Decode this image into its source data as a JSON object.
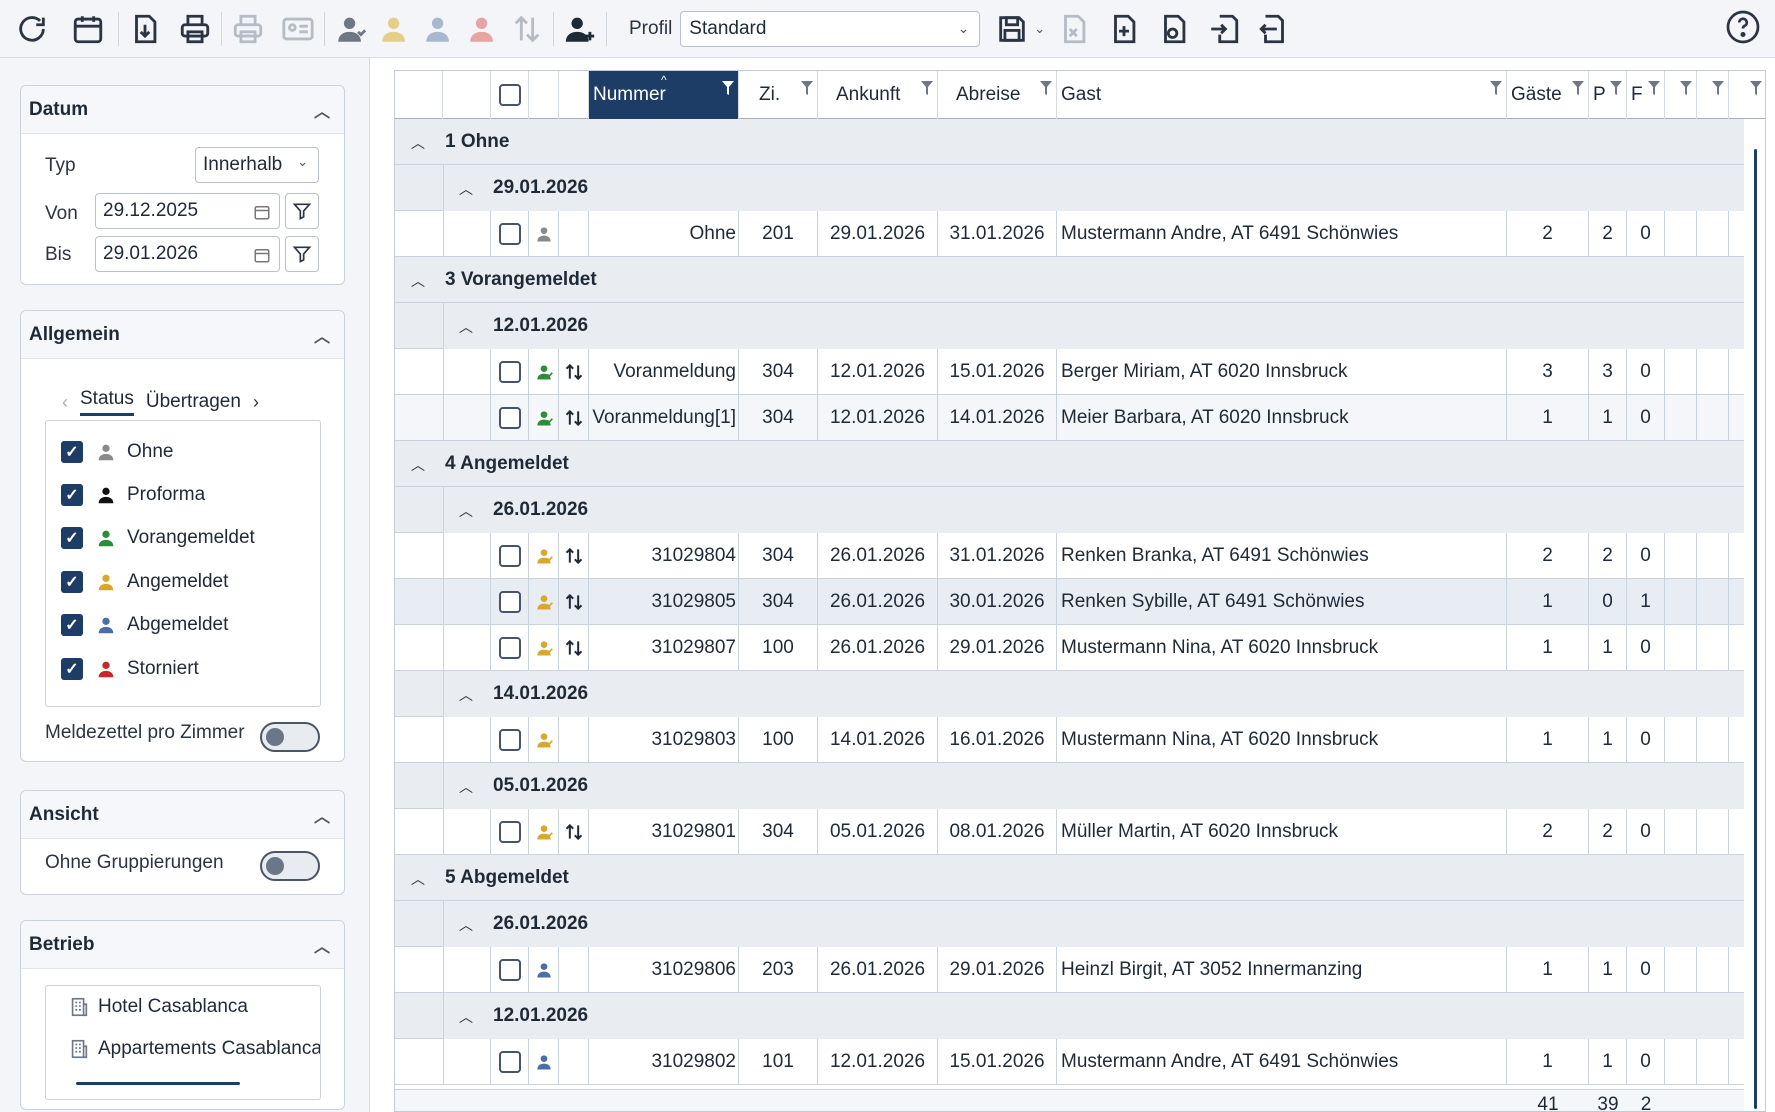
{
  "toolbar": {
    "profil_label": "Profil",
    "profil_value": "Standard"
  },
  "sidebar": {
    "datum": {
      "title": "Datum",
      "typ_label": "Typ",
      "typ_value": "Innerhalb",
      "von_label": "Von",
      "von_value": "29.12.2025",
      "bis_label": "Bis",
      "bis_value": "29.01.2026"
    },
    "allgemein": {
      "title": "Allgemein",
      "tabs": [
        "Status",
        "Übertragen"
      ],
      "status_items": [
        {
          "label": "Ohne",
          "color": "#8a8a8a"
        },
        {
          "label": "Proforma",
          "color": "#111111"
        },
        {
          "label": "Vorangemeldet",
          "color": "#2e8b3a"
        },
        {
          "label": "Angemeldet",
          "color": "#d9a82b"
        },
        {
          "label": "Abgemeldet",
          "color": "#4a6fa5"
        },
        {
          "label": "Storniert",
          "color": "#c62828"
        }
      ],
      "meldezettel_label": "Meldezettel pro Zimmer"
    },
    "ansicht": {
      "title": "Ansicht",
      "ohne_gruppierungen_label": "Ohne Gruppierungen"
    },
    "betrieb": {
      "title": "Betrieb",
      "items": [
        "Hotel Casablanca",
        "Appartements Casablanca"
      ]
    }
  },
  "grid": {
    "columns": {
      "nummer": "Nummer",
      "zi": "Zi.",
      "ankunft": "Ankunft",
      "abreise": "Abreise",
      "gast": "Gast",
      "gaeste": "Gäste",
      "p": "P",
      "f": "F"
    },
    "groups": [
      {
        "label": "1 Ohne",
        "sub": [
          {
            "date": "29.01.2026",
            "rows": [
              {
                "status": "Ohne",
                "arrows": false,
                "nummer": "Ohne",
                "zi": "201",
                "ankunft": "29.01.2026",
                "abreise": "31.01.2026",
                "gast": "Mustermann Andre, AT 6491 Schönwies",
                "gaeste": "2",
                "p": "2",
                "f": "0"
              }
            ]
          }
        ]
      },
      {
        "label": "3 Vorangemeldet",
        "sub": [
          {
            "date": "12.01.2026",
            "rows": [
              {
                "status": "Vorangemeldet",
                "arrows": true,
                "nummer": "Voranmeldung",
                "zi": "304",
                "ankunft": "12.01.2026",
                "abreise": "15.01.2026",
                "gast": "Berger Miriam, AT 6020 Innsbruck",
                "gaeste": "3",
                "p": "3",
                "f": "0"
              },
              {
                "status": "Vorangemeldet",
                "arrows": true,
                "nummer": "Voranmeldung[1]",
                "zi": "304",
                "ankunft": "12.01.2026",
                "abreise": "14.01.2026",
                "gast": "Meier Barbara, AT 6020 Innsbruck",
                "gaeste": "1",
                "p": "1",
                "f": "0"
              }
            ]
          }
        ]
      },
      {
        "label": "4 Angemeldet",
        "sub": [
          {
            "date": "26.01.2026",
            "rows": [
              {
                "status": "Angemeldet",
                "arrows": true,
                "nummer": "31029804",
                "zi": "304",
                "ankunft": "26.01.2026",
                "abreise": "31.01.2026",
                "gast": "Renken Branka, AT 6491 Schönwies",
                "gaeste": "2",
                "p": "2",
                "f": "0"
              },
              {
                "status": "Angemeldet",
                "arrows": true,
                "nummer": "31029805",
                "zi": "304",
                "ankunft": "26.01.2026",
                "abreise": "30.01.2026",
                "gast": "Renken Sybille, AT 6491 Schönwies",
                "gaeste": "1",
                "p": "0",
                "f": "1"
              },
              {
                "status": "Angemeldet",
                "arrows": true,
                "nummer": "31029807",
                "zi": "100",
                "ankunft": "26.01.2026",
                "abreise": "29.01.2026",
                "gast": "Mustermann Nina, AT 6020 Innsbruck",
                "gaeste": "1",
                "p": "1",
                "f": "0"
              }
            ]
          },
          {
            "date": "14.01.2026",
            "rows": [
              {
                "status": "Angemeldet",
                "arrows": false,
                "nummer": "31029803",
                "zi": "100",
                "ankunft": "14.01.2026",
                "abreise": "16.01.2026",
                "gast": "Mustermann Nina, AT 6020 Innsbruck",
                "gaeste": "1",
                "p": "1",
                "f": "0"
              }
            ]
          },
          {
            "date": "05.01.2026",
            "rows": [
              {
                "status": "Angemeldet",
                "arrows": true,
                "nummer": "31029801",
                "zi": "304",
                "ankunft": "05.01.2026",
                "abreise": "08.01.2026",
                "gast": "Müller Martin, AT 6020 Innsbruck",
                "gaeste": "2",
                "p": "2",
                "f": "0"
              }
            ]
          }
        ]
      },
      {
        "label": "5 Abgemeldet",
        "sub": [
          {
            "date": "26.01.2026",
            "rows": [
              {
                "status": "Abgemeldet",
                "arrows": false,
                "nummer": "31029806",
                "zi": "203",
                "ankunft": "26.01.2026",
                "abreise": "29.01.2026",
                "gast": "Heinzl Birgit, AT 3052 Innermanzing",
                "gaeste": "1",
                "p": "1",
                "f": "0"
              }
            ]
          },
          {
            "date": "12.01.2026",
            "rows": [
              {
                "status": "Abgemeldet",
                "arrows": false,
                "nummer": "31029802",
                "zi": "101",
                "ankunft": "12.01.2026",
                "abreise": "15.01.2026",
                "gast": "Mustermann Andre, AT 6491 Schönwies",
                "gaeste": "1",
                "p": "1",
                "f": "0"
              }
            ]
          }
        ]
      }
    ],
    "totals": {
      "gaeste": "41",
      "p": "39",
      "f": "2"
    }
  },
  "colors": {
    "accent": "#1e3d66",
    "status_ohne": "#8a8a8a",
    "status_vorangemeldet": "#2e8b3a",
    "status_angemeldet": "#d9a82b",
    "status_abgemeldet": "#4a6fa5",
    "status_storniert": "#c62828"
  }
}
